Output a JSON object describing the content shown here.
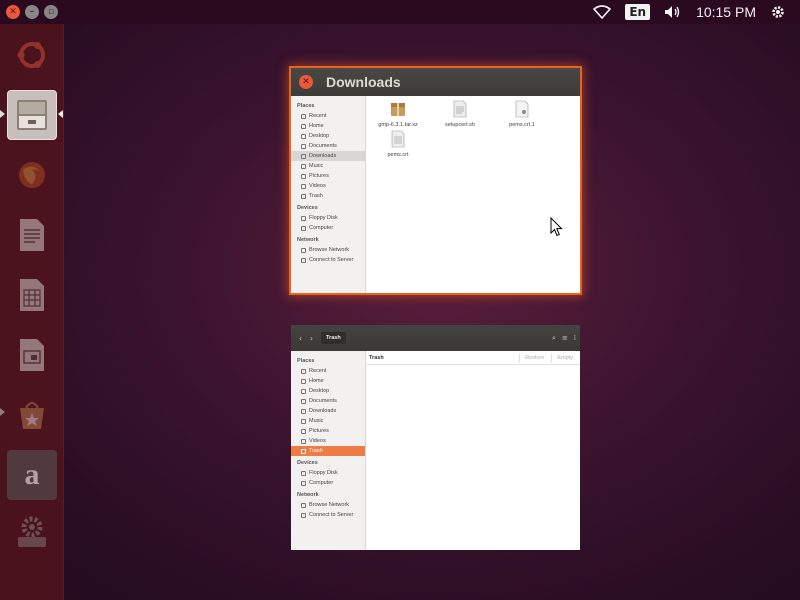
{
  "top_panel": {
    "language": "En",
    "clock": "10:15 PM",
    "icons": [
      "close-icon",
      "minimize-icon",
      "maximize-icon",
      "wifi-icon",
      "keyboard-language-icon",
      "volume-icon",
      "settings-gear-icon"
    ]
  },
  "launcher": {
    "items": [
      {
        "name": "ubuntu-dash-icon"
      },
      {
        "name": "files-icon",
        "active": true
      },
      {
        "name": "firefox-icon"
      },
      {
        "name": "libreoffice-writer-icon"
      },
      {
        "name": "libreoffice-calc-icon"
      },
      {
        "name": "libreoffice-impress-icon"
      },
      {
        "name": "software-center-icon"
      },
      {
        "name": "amazon-icon",
        "glyph": "a"
      },
      {
        "name": "system-settings-icon"
      }
    ]
  },
  "downloads_window": {
    "title": "Downloads",
    "sidebar": {
      "places_heading": "Places",
      "places": [
        "Recent",
        "Home",
        "Desktop",
        "Documents",
        "Downloads",
        "Music",
        "Pictures",
        "Videos",
        "Trash"
      ],
      "devices_heading": "Devices",
      "devices": [
        "Floppy Disk",
        "Computer"
      ],
      "network_heading": "Network",
      "network": [
        "Browse Network",
        "Connect to Server"
      ]
    },
    "files": [
      "gmp-6.3.1.tar.xz",
      "setupcert.sh",
      "pems.crt.1",
      "pems.crt"
    ]
  },
  "trash_window": {
    "path": "Trash",
    "location_label": "Trash",
    "restore_label": "Restore",
    "empty_label": "Empty",
    "sidebar": {
      "places_heading": "Places",
      "places": [
        "Recent",
        "Home",
        "Desktop",
        "Documents",
        "Downloads",
        "Music",
        "Pictures",
        "Videos",
        "Trash"
      ],
      "devices_heading": "Devices",
      "devices": [
        "Floppy Disk",
        "Computer"
      ],
      "network_heading": "Network",
      "network": [
        "Browse Network",
        "Connect to Server"
      ]
    }
  },
  "colors": {
    "accent": "#e8641e",
    "selected_sidebar": "#ef7b45",
    "panel": "#2b0a1f",
    "close_button": "#e9593a"
  }
}
